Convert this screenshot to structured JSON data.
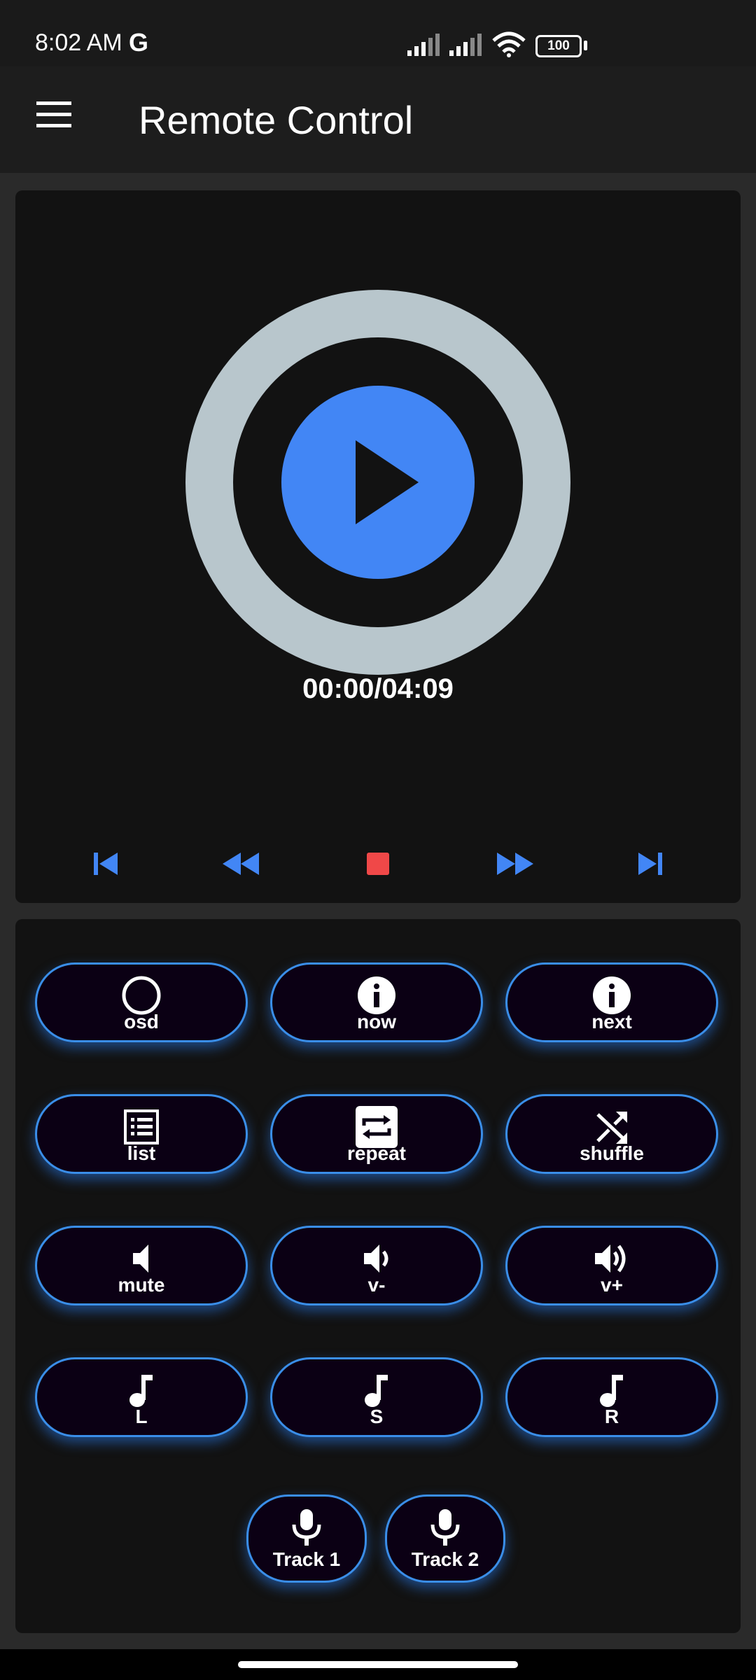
{
  "status_bar": {
    "time": "8:02 AM",
    "google_glyph": "G",
    "battery": "100",
    "icons": [
      "signal-icon",
      "signal-icon",
      "wifi-icon",
      "battery-icon"
    ]
  },
  "app_bar": {
    "title": "Remote Control",
    "menu_icon": "hamburger-menu-icon"
  },
  "player": {
    "time": "00:00/04:09",
    "play_icon": "play-icon",
    "controls": [
      {
        "name": "skip-previous",
        "icon": "skip-previous-icon"
      },
      {
        "name": "rewind",
        "icon": "rewind-icon"
      },
      {
        "name": "stop",
        "icon": "stop-icon"
      },
      {
        "name": "fast-forward",
        "icon": "fast-forward-icon"
      },
      {
        "name": "skip-next",
        "icon": "skip-next-icon"
      }
    ]
  },
  "buttons": {
    "osd": "osd",
    "now": "now",
    "next": "next",
    "list": "list",
    "repeat": "repeat",
    "shuffle": "shuffle",
    "mute": "mute",
    "vol_down": "v-",
    "vol_up": "v+",
    "left": "L",
    "stereo": "S",
    "right": "R",
    "track1": "Track 1",
    "track2": "Track 2"
  },
  "colors": {
    "accent": "#4286f5",
    "stop": "#f04848",
    "ring": "#b8c6cc",
    "button_border": "#3a8ee8",
    "button_fill": "#0b0014"
  }
}
